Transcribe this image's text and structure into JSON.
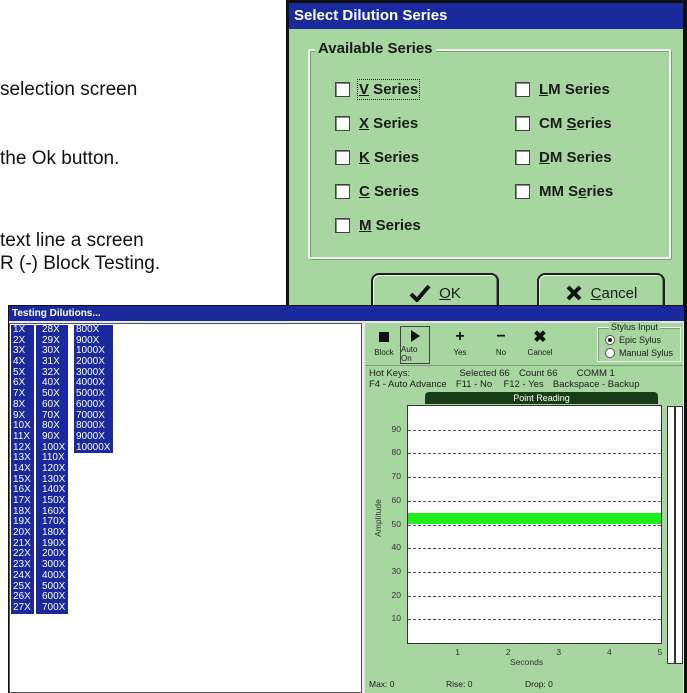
{
  "document": {
    "line1": "selection screen",
    "line2": "the Ok button.",
    "line3": "text line a screen",
    "line4": "R (-) Block Testing."
  },
  "dialog": {
    "title": "Select Dilution Series",
    "group_label": "Available Series",
    "left_series": [
      {
        "hotkey": "V",
        "rest": " Series",
        "checked": false,
        "focused": true
      },
      {
        "hotkey": "X",
        "rest": " Series",
        "checked": false
      },
      {
        "hotkey": "K",
        "rest": " Series",
        "checked": false
      },
      {
        "hotkey": "C",
        "rest": " Series",
        "checked": false
      },
      {
        "hotkey": "M",
        "rest": " Series",
        "checked": false
      }
    ],
    "right_series": [
      {
        "pre": "",
        "hotkey": "L",
        "rest": "M Series",
        "checked": false
      },
      {
        "pre": "CM ",
        "hotkey": "S",
        "rest": "eries",
        "checked": false
      },
      {
        "pre": "",
        "hotkey": "D",
        "rest": "M Series",
        "checked": false
      },
      {
        "pre": "MM S",
        "hotkey": "e",
        "rest": "ries",
        "checked": false
      }
    ],
    "ok": {
      "hotkey": "O",
      "rest": "K"
    },
    "cancel": {
      "hotkey": "C",
      "rest": "ancel"
    }
  },
  "testing": {
    "title": "Testing Dilutions...",
    "col1": [
      "1X",
      "2X",
      "3X",
      "4X",
      "5X",
      "6X",
      "7X",
      "8X",
      "9X",
      "10X",
      "11X",
      "12X",
      "13X",
      "14X",
      "15X",
      "16X",
      "17X",
      "18X",
      "19X",
      "20X",
      "21X",
      "22X",
      "23X",
      "24X",
      "25X",
      "26X",
      "27X"
    ],
    "col2": [
      "28X",
      "29X",
      "30X",
      "31X",
      "32X",
      "40X",
      "50X",
      "60X",
      "70X",
      "80X",
      "90X",
      "100X",
      "110X",
      "120X",
      "130X",
      "140X",
      "150X",
      "160X",
      "170X",
      "180X",
      "190X",
      "200X",
      "300X",
      "400X",
      "500X",
      "600X",
      "700X"
    ],
    "col3": [
      "800X",
      "900X",
      "1000X",
      "2000X",
      "3000X",
      "4000X",
      "5000X",
      "6000X",
      "7000X",
      "8000X",
      "9000X",
      "10000X"
    ],
    "toolbar": {
      "block": "Block",
      "auto_on": "Auto On",
      "yes": "Yes",
      "no": "No",
      "cancel": "Cancel"
    },
    "stylus": {
      "legend": "Stylus Input",
      "opt1": "Epic Sylus",
      "opt2": "Manual Sylus",
      "selected": "Epic Sylus"
    },
    "hotkeys": {
      "label": "Hot Keys:",
      "selected": "Selected 66",
      "count": "Count 66",
      "comm": "COMM 1",
      "f4": "F4 - Auto Advance",
      "f11": "F11 - No",
      "f12": "F12 - Yes",
      "backspace": "Backspace - Backup"
    },
    "status": {
      "max": "Max: 0",
      "rise": "Rise: 0",
      "drop": "Drop: 0"
    }
  },
  "chart_data": {
    "type": "line",
    "title": "Point Reading",
    "xlabel": "Seconds",
    "ylabel": "Amplitude",
    "xlim": [
      0,
      5
    ],
    "ylim": [
      0,
      100
    ],
    "x_ticks": [
      1,
      2,
      3,
      4,
      5
    ],
    "y_ticks": [
      10,
      20,
      30,
      40,
      50,
      60,
      70,
      80,
      90
    ],
    "grid": true,
    "band": {
      "from": 50,
      "to": 55,
      "color": "#1eee1e"
    },
    "series": []
  },
  "colors": {
    "titlebar": "#1a2a9c",
    "panel": "#a8d6a0",
    "chart_header": "#173d17",
    "band": "#1eee1e"
  }
}
